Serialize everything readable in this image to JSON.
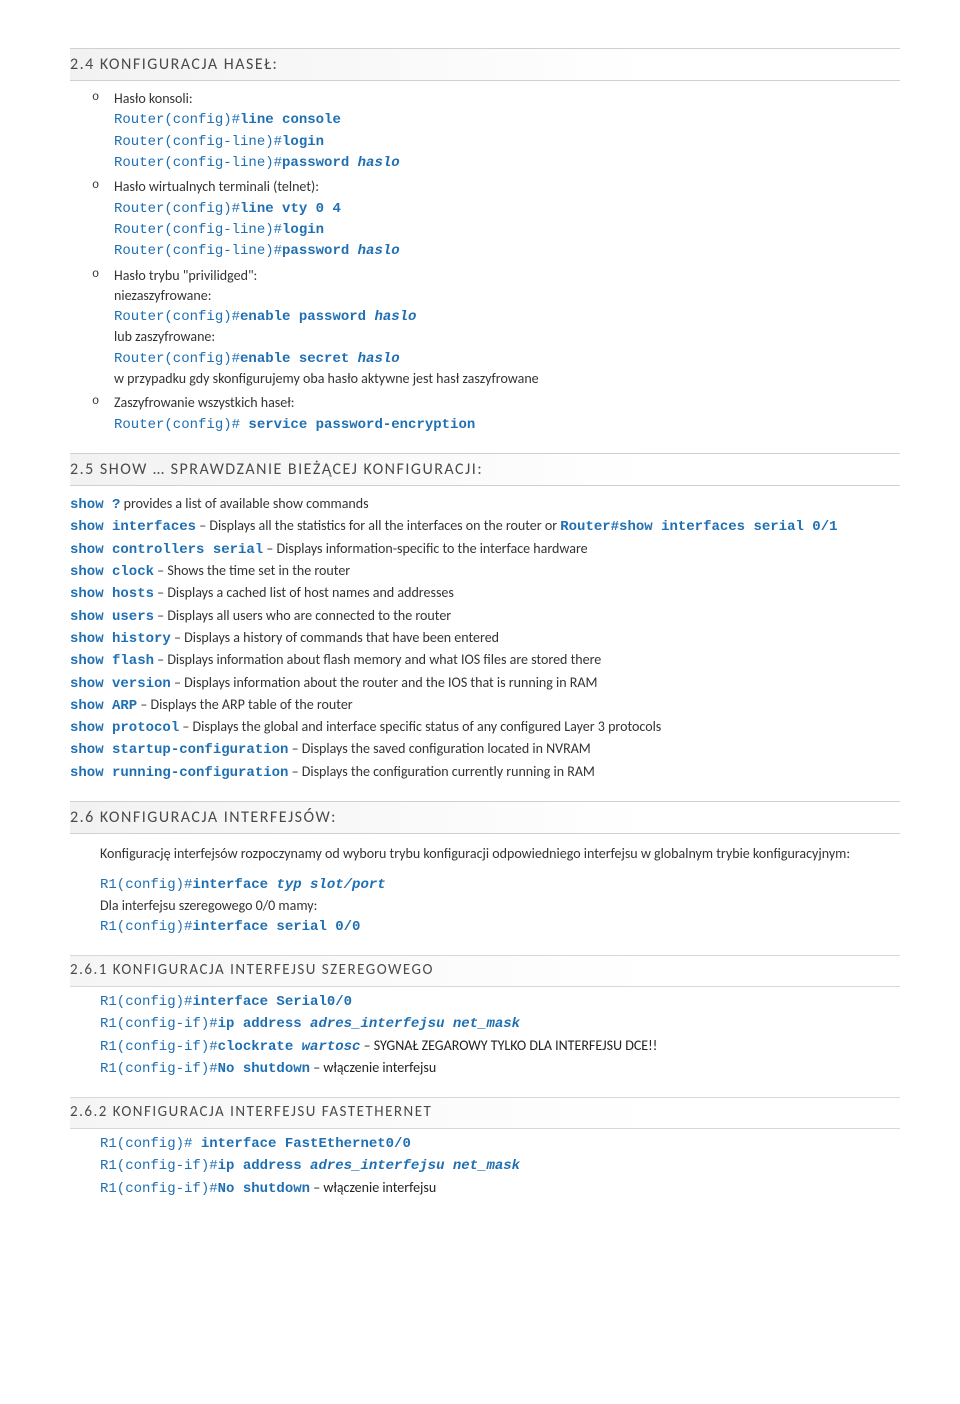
{
  "s24": {
    "title": "2.4   KONFIGURACJA HASEŁ:",
    "items": [
      {
        "label": "Hasło konsoli:",
        "lines": [
          {
            "prompt": "Router(config)#",
            "cmd": "line console",
            "arg": ""
          },
          {
            "prompt": "Router(config-line)#",
            "cmd": "login",
            "arg": ""
          },
          {
            "prompt": "Router(config-line)#",
            "cmd": "password ",
            "arg": "haslo"
          }
        ]
      },
      {
        "label": "Hasło wirtualnych terminali (telnet):",
        "lines": [
          {
            "prompt": "Router(config)#",
            "cmd": "line vty 0 4",
            "arg": ""
          },
          {
            "prompt": "Router(config-line)#",
            "cmd": "login",
            "arg": ""
          },
          {
            "prompt": "Router(config-line)#",
            "cmd": "password ",
            "arg": "haslo"
          }
        ]
      },
      {
        "label": "Hasło trybu \"privilidged\":",
        "t1": "niezaszyfrowane:",
        "l1": {
          "prompt": "Router(config)#",
          "cmd": "enable password ",
          "arg": "haslo"
        },
        "t2": "lub zaszyfrowane:",
        "l2": {
          "prompt": "Router(config)#",
          "cmd": "enable secret ",
          "arg": "haslo"
        },
        "t3": "w przypadku gdy skonfigurujemy oba hasło aktywne jest hasł zaszyfrowane"
      },
      {
        "label": "Zaszyfrowanie wszystkich haseł:",
        "lines": [
          {
            "prompt": "Router(config)# ",
            "cmd": "service password-encryption",
            "arg": ""
          }
        ]
      }
    ]
  },
  "s25": {
    "title": "2.5   SHOW … SPRAWDZANIE BIEŻĄCEJ KONFIGURACJI:",
    "rows": [
      {
        "cmd": "show ?",
        "desc": " provides a list of available show commands"
      },
      {
        "cmd": "show interfaces",
        "desc": " – Displays all the statistics for all the interfaces on the router or ",
        "tail": "Router#show interfaces serial 0/1"
      },
      {
        "cmd": "show controllers serial",
        "desc": " – Displays information-specific to the interface hardware"
      },
      {
        "cmd": "show clock",
        "desc": " – Shows the time set in the router"
      },
      {
        "cmd": "show hosts",
        "desc": " – Displays a cached list of host names and addresses"
      },
      {
        "cmd": "show users",
        "desc": " – Displays all users who are connected to the router"
      },
      {
        "cmd": "show history",
        "desc": " – Displays a history of commands that have been entered"
      },
      {
        "cmd": "show flash",
        "desc": " – Displays information about flash memory and what IOS files are stored there"
      },
      {
        "cmd": "show version",
        "desc": " – Displays information about the router and the IOS that is running in RAM"
      },
      {
        "cmd": "show ARP",
        "desc": " – Displays the ARP table of the router"
      },
      {
        "cmd": "show protocol",
        "desc": " – Displays the global and interface specific status of any configured Layer 3 protocols"
      },
      {
        "cmd": "show startup-configuration",
        "desc": " – Displays the saved configuration located in NVRAM"
      },
      {
        "cmd": "show running-configuration",
        "desc": " – Displays the configuration currently running in RAM"
      }
    ]
  },
  "s26": {
    "title": "2.6   KONFIGURACJA INTERFEJSÓW:",
    "intro": "Konfigurację interfejsów rozpoczynamy od wyboru trybu konfiguracji odpowiedniego interfejsu w globalnym trybie konfiguracyjnym:",
    "l1": {
      "prompt": "R1(config)#",
      "cmd": "interface ",
      "arg": "typ slot/port"
    },
    "t2": "Dla interfejsu szeregowego 0/0  mamy:",
    "l2": {
      "prompt": "R1(config)#",
      "cmd": "interface serial 0/0",
      "arg": ""
    }
  },
  "s261": {
    "title": "2.6.1  KONFIGURACJA INTERFEJSU SZEREGOWEGO",
    "rows": [
      {
        "prompt": "R1(config)#",
        "cmd": "interface Serial0/0",
        "arg": "",
        "after": ""
      },
      {
        "prompt": "R1(config-if)#",
        "cmd": "ip address ",
        "arg": "adres_interfejsu net_mask",
        "after": ""
      },
      {
        "prompt": "R1(config-if)#",
        "cmd": "clockrate ",
        "arg": "wartosc",
        "after": " – SYGNAŁ ZEGAROWY TYLKO DLA INTERFEJSU DCE!!"
      },
      {
        "prompt": "R1(config-if)#",
        "cmd": "No shutdown",
        "arg": "",
        "after": " –  włączenie interfejsu"
      }
    ]
  },
  "s262": {
    "title": "2.6.2  KONFIGURACJA INTERFEJSU FASTETHERNET",
    "rows": [
      {
        "prompt": "R1(config)# ",
        "cmd": "interface FastEthernet0/0",
        "arg": "",
        "after": ""
      },
      {
        "prompt": "R1(config-if)#",
        "cmd": "ip address ",
        "arg": "adres_interfejsu net_mask",
        "after": ""
      },
      {
        "prompt": "R1(config-if)#",
        "cmd": "No shutdown",
        "arg": "",
        "after": " –  włączenie interfejsu"
      }
    ]
  }
}
